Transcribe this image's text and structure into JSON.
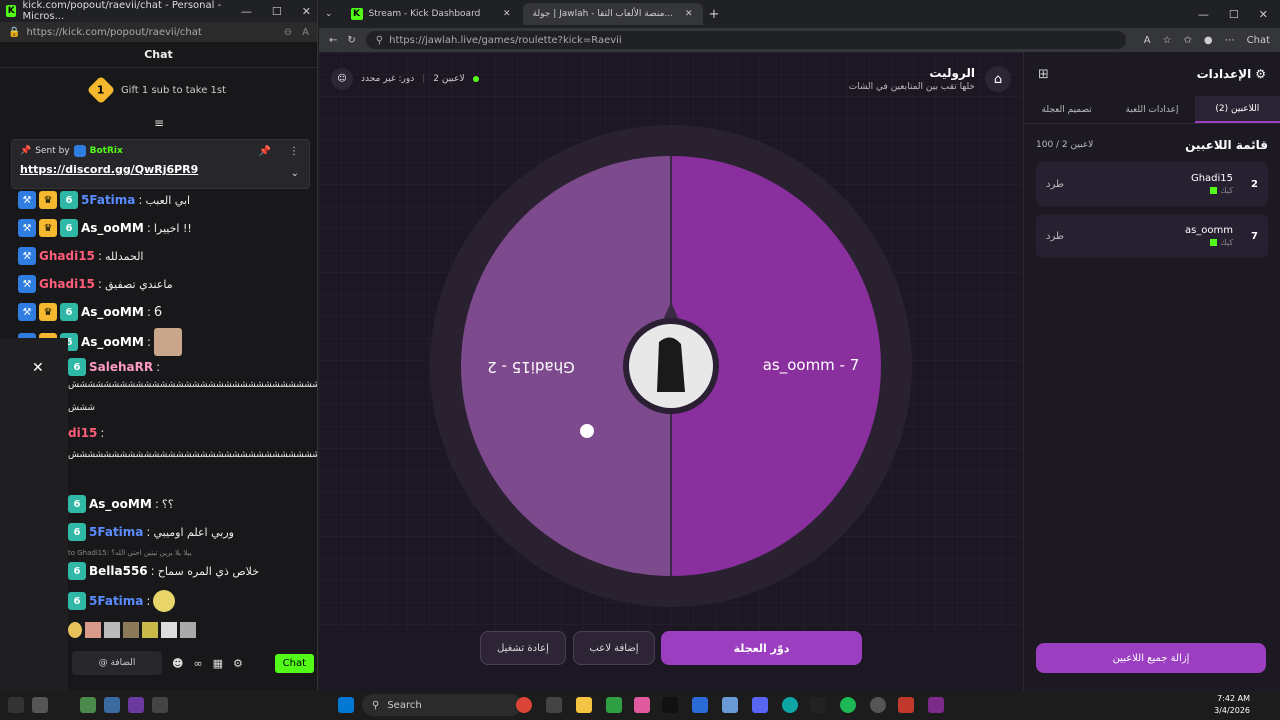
{
  "left_window": {
    "title": "kick.com/popout/raevii/chat - Personal - Micros...",
    "url": "https://kick.com/popout/raevii/chat",
    "chat_title": "Chat",
    "gift_text": "Gift 1 sub to take 1st",
    "gift_count": "1",
    "pinned": {
      "sent_by": "Sent by",
      "bot_name": "BotRix",
      "link": "https://discord.gg/QwRj6PR9"
    },
    "messages": [
      {
        "user": "5Fatima",
        "text": "ابي العبب",
        "color": "#5b8cff"
      },
      {
        "user": "As_ooMM",
        "text": "اخييرا !!",
        "color": "#ffffff"
      },
      {
        "user": "Ghadi15",
        "text": "الحمدلله",
        "color": "#ff5d7a"
      },
      {
        "user": "Ghadi15",
        "text": "ماعندي تصفيق",
        "color": "#ff5d7a"
      },
      {
        "user": "As_ooMM",
        "text": "6",
        "color": "#ffffff"
      },
      {
        "user": "As_ooMM",
        "text": "",
        "color": "#ffffff"
      },
      {
        "user": "SalehaRR",
        "text": "",
        "color": "#ff9ac0"
      },
      {
        "user": "di15",
        "text": "",
        "color": "#ff5d7a"
      },
      {
        "user": "As_ooMM",
        "text": "؟؟",
        "color": "#ffffff"
      },
      {
        "user": "5Fatima",
        "text": "وربي اعلم اوميبي",
        "color": "#5b8cff"
      },
      {
        "user": "Bella556",
        "text": "خلاص ذي المره سماح",
        "color": "#ffffff"
      },
      {
        "user": "5Fatima",
        "text": "",
        "color": "#5b8cff"
      }
    ],
    "reply_to": "to Ghadi15: ييلا يلا يرين تيتين احتي الله؟",
    "spam_line": "شششششششششششششششششششششششششششششششششش",
    "spam_line2": "ششش",
    "chat_input_placeholder": "@ الضافة",
    "send_label": "Chat"
  },
  "right_window": {
    "tabs": [
      {
        "label": "Stream - Kick Dashboard",
        "active": false
      },
      {
        "label": "جولة | Jawlah - منصة الألعاب التفا...",
        "active": true
      }
    ],
    "url": "https://jawlah.live/games/roulette?kick=Raevii",
    "chat_label": "Chat",
    "game": {
      "title": "الروليت",
      "subtitle": "خلها تقب بين المتابعين في الشات",
      "players_count_label": "2 لاعبين",
      "turn_label": "دور: غير محدد",
      "buttons": {
        "spin": "دوّر العجلة",
        "add_player": "إضافة لاعب",
        "restart": "إعادة تشغيل"
      }
    },
    "settings": {
      "title": "الإعدادات",
      "tabs": [
        "اللاعبين (2)",
        "إعدادات اللعبة",
        "تصميم العجلة"
      ],
      "list_title": "قائمة اللاعبين",
      "list_count": "100 / 2 لاعبين",
      "players": [
        {
          "name": "Ghadi15",
          "tag": "كيك",
          "number": "2",
          "kick_label": "طرد"
        },
        {
          "name": "as_oomm",
          "tag": "كيك",
          "number": "7",
          "kick_label": "طرد"
        }
      ],
      "remove_all": "إزالة جميع اللاعبين"
    }
  },
  "chart_data": {
    "type": "pie",
    "categories": [
      "as_oomm - 7",
      "Ghadi15 - 2"
    ],
    "values": [
      50,
      50
    ],
    "colors": [
      "#8a2f9e",
      "#7e4a8e"
    ]
  },
  "taskbar": {
    "search_label": "Search",
    "time": "7:42 AM",
    "date": "3/4/2026"
  }
}
